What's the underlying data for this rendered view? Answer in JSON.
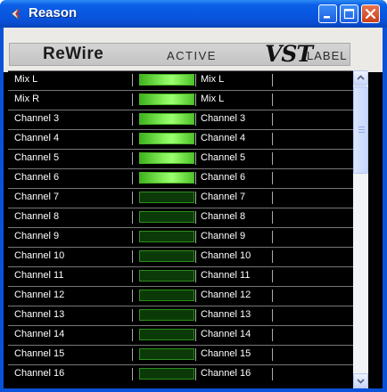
{
  "window": {
    "title": "Reason",
    "icon": "reason-app-icon",
    "controls": [
      "minimize-icon",
      "maximize-icon",
      "close-icon"
    ]
  },
  "header": {
    "rewire": "ReWire",
    "active": "ACTIVE",
    "vst": "VST",
    "label": "LABEL"
  },
  "rows": [
    {
      "name": "Mix L",
      "active": true,
      "label": "Mix L"
    },
    {
      "name": "Mix R",
      "active": true,
      "label": "Mix L"
    },
    {
      "name": "Channel 3",
      "active": true,
      "label": "Channel 3"
    },
    {
      "name": "Channel 4",
      "active": true,
      "label": "Channel 4"
    },
    {
      "name": "Channel 5",
      "active": true,
      "label": "Channel 5"
    },
    {
      "name": "Channel 6",
      "active": true,
      "label": "Channel 6"
    },
    {
      "name": "Channel 7",
      "active": false,
      "label": "Channel 7"
    },
    {
      "name": "Channel 8",
      "active": false,
      "label": "Channel 8"
    },
    {
      "name": "Channel 9",
      "active": false,
      "label": "Channel 9"
    },
    {
      "name": "Channel 10",
      "active": false,
      "label": "Channel 10"
    },
    {
      "name": "Channel 11",
      "active": false,
      "label": "Channel 11"
    },
    {
      "name": "Channel 12",
      "active": false,
      "label": "Channel 12"
    },
    {
      "name": "Channel 13",
      "active": false,
      "label": "Channel 13"
    },
    {
      "name": "Channel 14",
      "active": false,
      "label": "Channel 14"
    },
    {
      "name": "Channel 15",
      "active": false,
      "label": "Channel 15"
    },
    {
      "name": "Channel 16",
      "active": false,
      "label": "Channel 16"
    }
  ],
  "colors": {
    "titlebar": "#0a56e0",
    "meter_on": "#86f25b",
    "meter_off": "#0b3a08"
  }
}
